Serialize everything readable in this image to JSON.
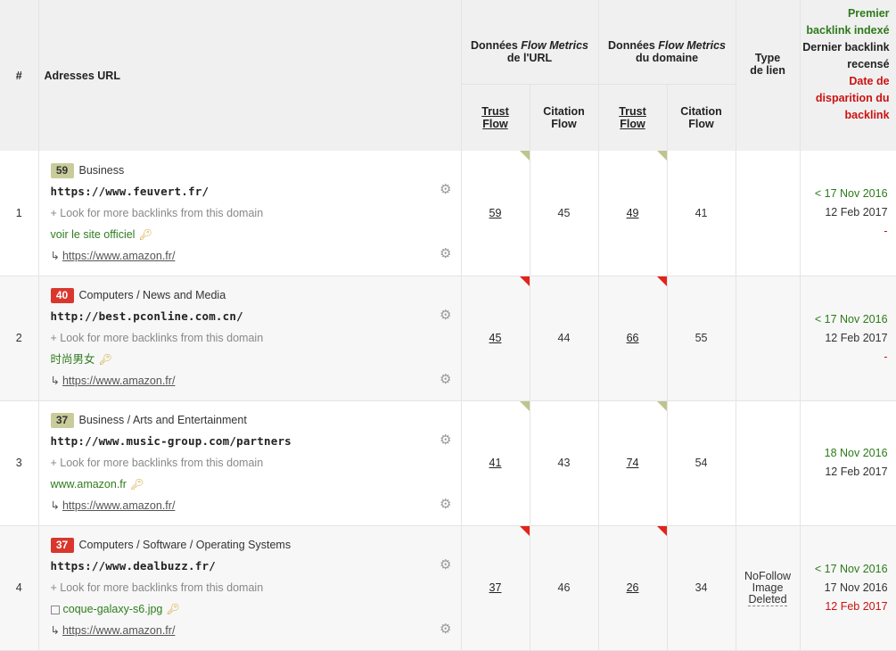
{
  "header": {
    "hash": "#",
    "urls": "Adresses URL",
    "url_group_pre": "Données ",
    "url_group_em": "Flow Metrics",
    "url_group_post": "de l'URL",
    "dom_group_pre": "Données ",
    "dom_group_em": "Flow Metrics",
    "dom_group_post": "du domaine",
    "tf1": "Trust",
    "tf2": "Flow",
    "cf1": "Citation",
    "cf2": "Flow",
    "type1": "Type",
    "type2": "de lien",
    "first1": "Premier",
    "first2": "backlink indexé",
    "last1": "Dernier backlink",
    "last2": "recensé",
    "gone1": "Date de",
    "gone2": "disparition du",
    "gone3": "backlink"
  },
  "more_text": "+ Look for more backlinks from this domain",
  "rows": [
    {
      "index": "1",
      "score": "59",
      "category": "Business",
      "url": "https://www.feuvert.fr/",
      "anchor": "voir le site officiel",
      "target": "https://www.amazon.fr/",
      "url_tf": "59",
      "url_cf": "45",
      "dom_tf": "49",
      "dom_cf": "41",
      "type": "",
      "type2": "",
      "type3": "",
      "first": "< 17 Nov 2016",
      "last": "12 Feb 2017",
      "gone": "-"
    },
    {
      "index": "2",
      "score": "40",
      "category": "Computers / News and Media",
      "url": "http://best.pconline.com.cn/",
      "anchor": "时尚男女",
      "target": "https://www.amazon.fr/",
      "url_tf": "45",
      "url_cf": "44",
      "dom_tf": "66",
      "dom_cf": "55",
      "type": "",
      "type2": "",
      "type3": "",
      "first": "< 17 Nov 2016",
      "last": "12 Feb 2017",
      "gone": "-"
    },
    {
      "index": "3",
      "score": "37",
      "category": "Business / Arts and Entertainment",
      "url": "http://www.music-group.com/partners",
      "anchor": "www.amazon.fr",
      "target": "https://www.amazon.fr/",
      "url_tf": "41",
      "url_cf": "43",
      "dom_tf": "74",
      "dom_cf": "54",
      "type": "",
      "type2": "",
      "type3": "",
      "first": "18 Nov 2016",
      "last": "12 Feb 2017",
      "gone": ""
    },
    {
      "index": "4",
      "score": "37",
      "category": "Computers / Software / Operating Systems",
      "url": "https://www.dealbuzz.fr/",
      "anchor": "coque-galaxy-s6.jpg",
      "target": "https://www.amazon.fr/",
      "url_tf": "37",
      "url_cf": "46",
      "dom_tf": "26",
      "dom_cf": "34",
      "type": "NoFollow",
      "type2": "Image",
      "type3": "Deleted",
      "first": "< 17 Nov 2016",
      "last": "17 Nov 2016",
      "gone": "12 Feb 2017"
    }
  ],
  "colors": {
    "score_olive": "#c9cc9a",
    "score_red": "#d9372e",
    "first_green": "#2d7a1a",
    "gone_red": "#cc1111"
  },
  "icons": [
    "gear-icon",
    "key-icon",
    "image-icon",
    "return-arrow-icon"
  ]
}
